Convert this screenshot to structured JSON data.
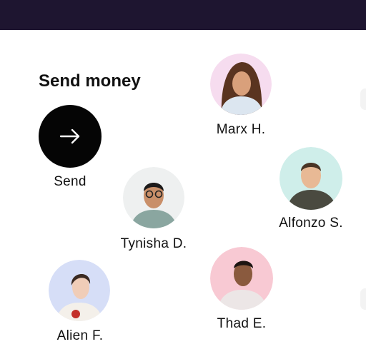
{
  "header": {
    "title": "Send money"
  },
  "send": {
    "label": "Send",
    "icon": "arrow-right-icon"
  },
  "contacts": [
    {
      "name": "Marx H.",
      "bg": "#f6dcef",
      "skin": "#d9a07b",
      "hair": "#5a3420",
      "shirt": "#dce6f0"
    },
    {
      "name": "Alfonzo S.",
      "bg": "#cfeeea",
      "skin": "#e8b995",
      "hair": "#4a3526",
      "shirt": "#4a4a40"
    },
    {
      "name": "Tynisha D.",
      "bg": "#eef0f0",
      "skin": "#c98f69",
      "hair": "#1c1a1a",
      "shirt": "#8aa6a0"
    },
    {
      "name": "Thad E.",
      "bg": "#f8c9d3",
      "skin": "#8a5a3e",
      "hair": "#1c1512",
      "shirt": "#ece6e6"
    },
    {
      "name": "Alien F.",
      "bg": "#d6def7",
      "skin": "#f0cdb8",
      "hair": "#3a2a22",
      "shirt": "#f4f0ea"
    }
  ]
}
